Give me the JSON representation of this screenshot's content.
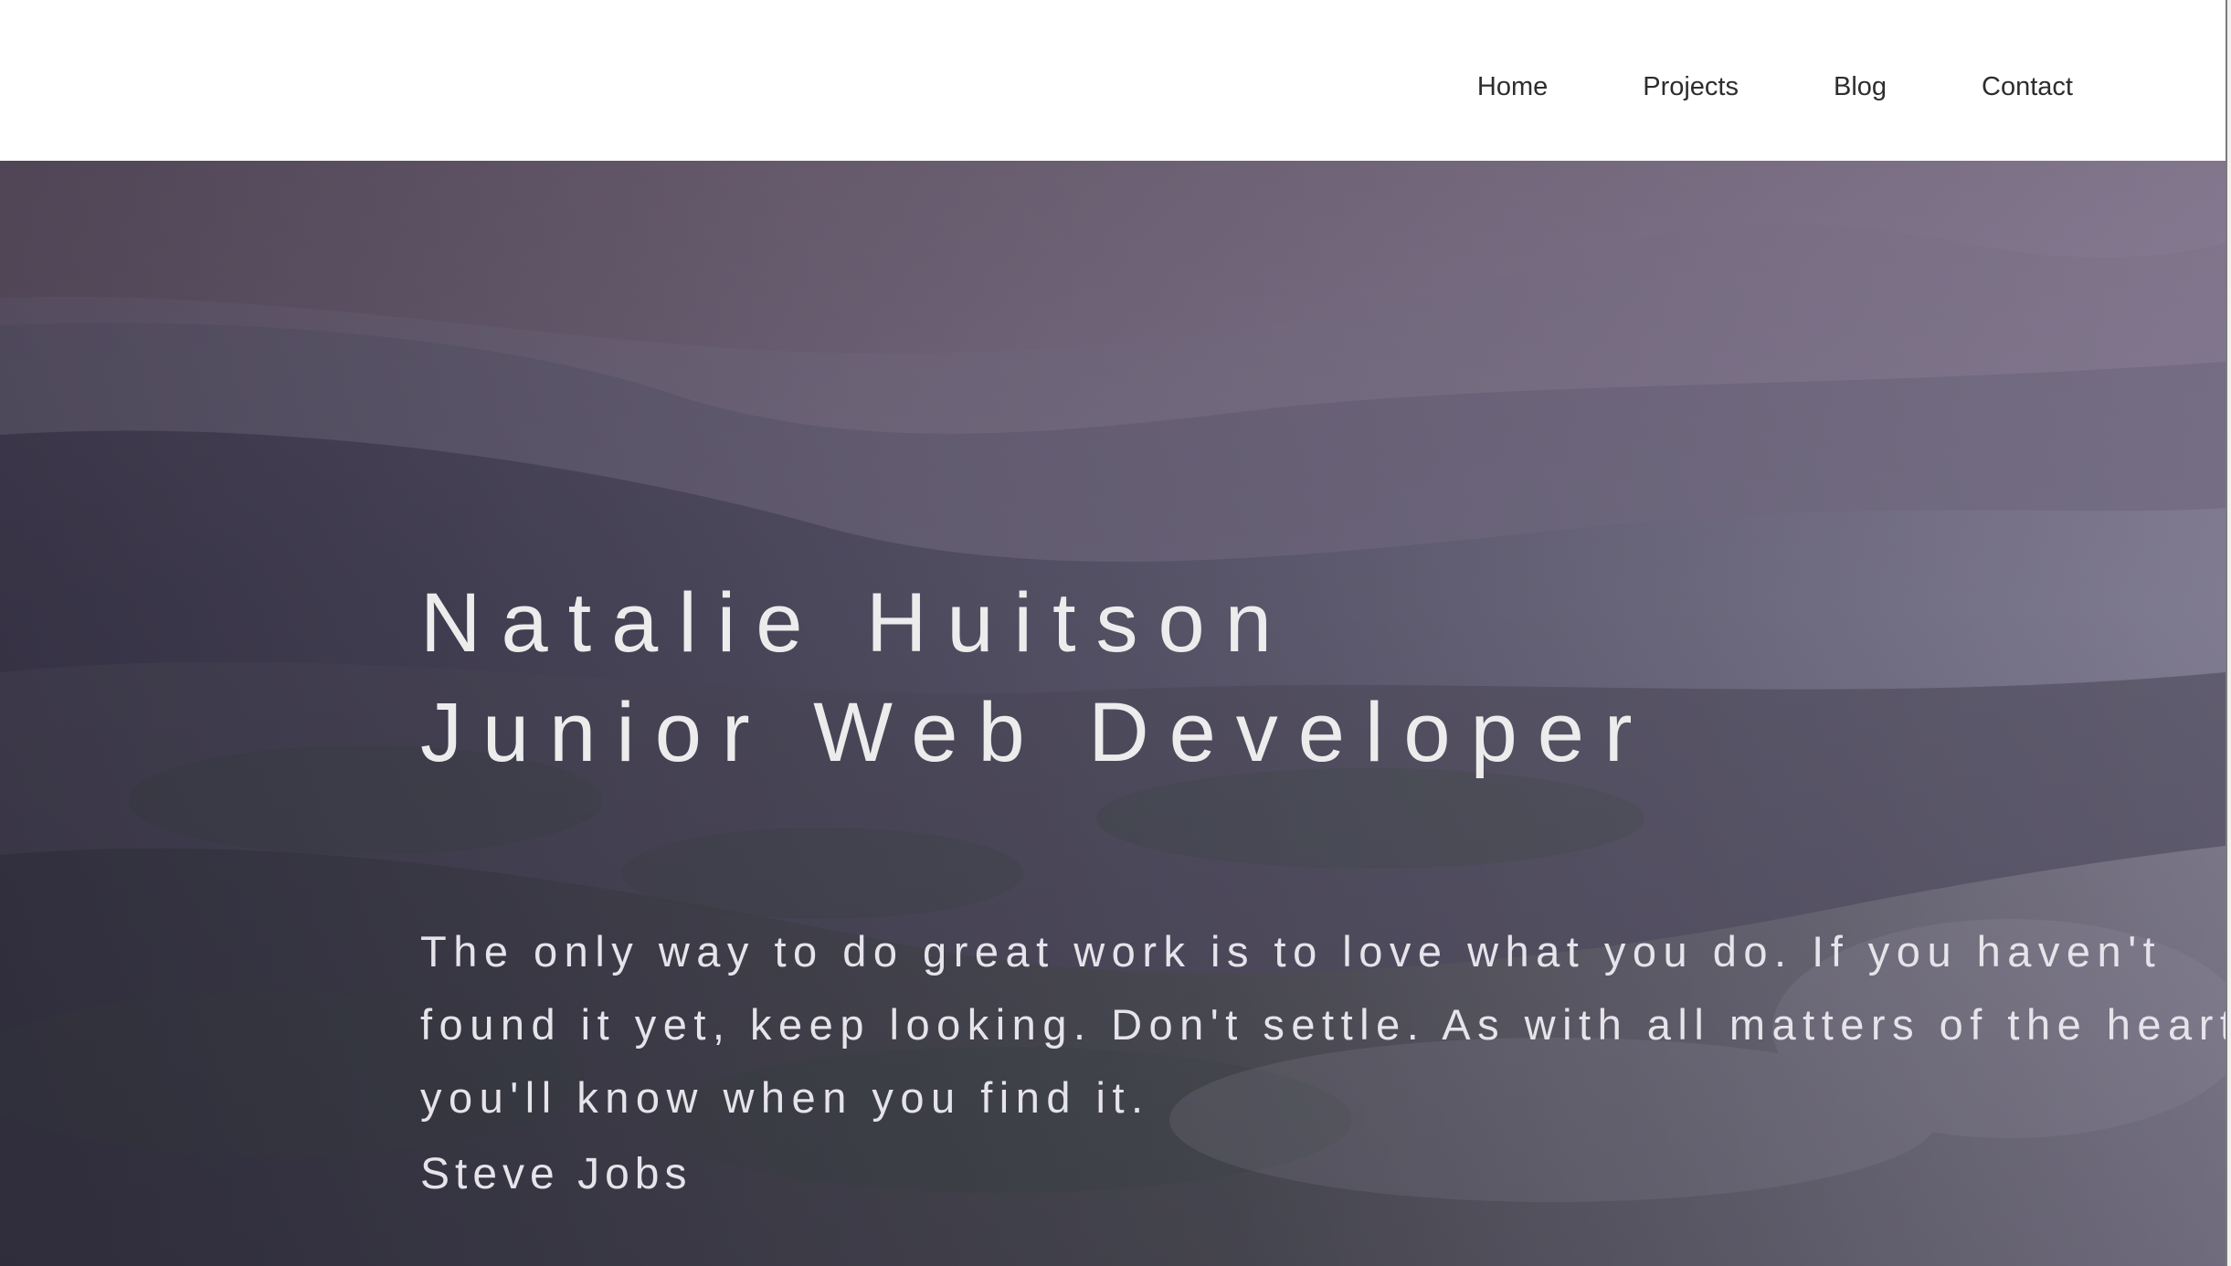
{
  "nav": {
    "items": [
      {
        "label": "Home"
      },
      {
        "label": "Projects"
      },
      {
        "label": "Blog"
      },
      {
        "label": "Contact"
      }
    ]
  },
  "hero": {
    "name": "Natalie Huitson",
    "role": "Junior Web Developer",
    "quote_lines": [
      "The only way to do great work is to love what you do. If you haven't",
      "found it yet, keep looking. Don't settle. As with all matters of the heart,",
      "you'll know when you find it."
    ],
    "quote_author": "Steve Jobs"
  },
  "colors": {
    "header_bg": "#ffffff",
    "nav_text": "#2d2d2d",
    "hero_text": "#ececec",
    "hero_tint": "#6e6780"
  }
}
